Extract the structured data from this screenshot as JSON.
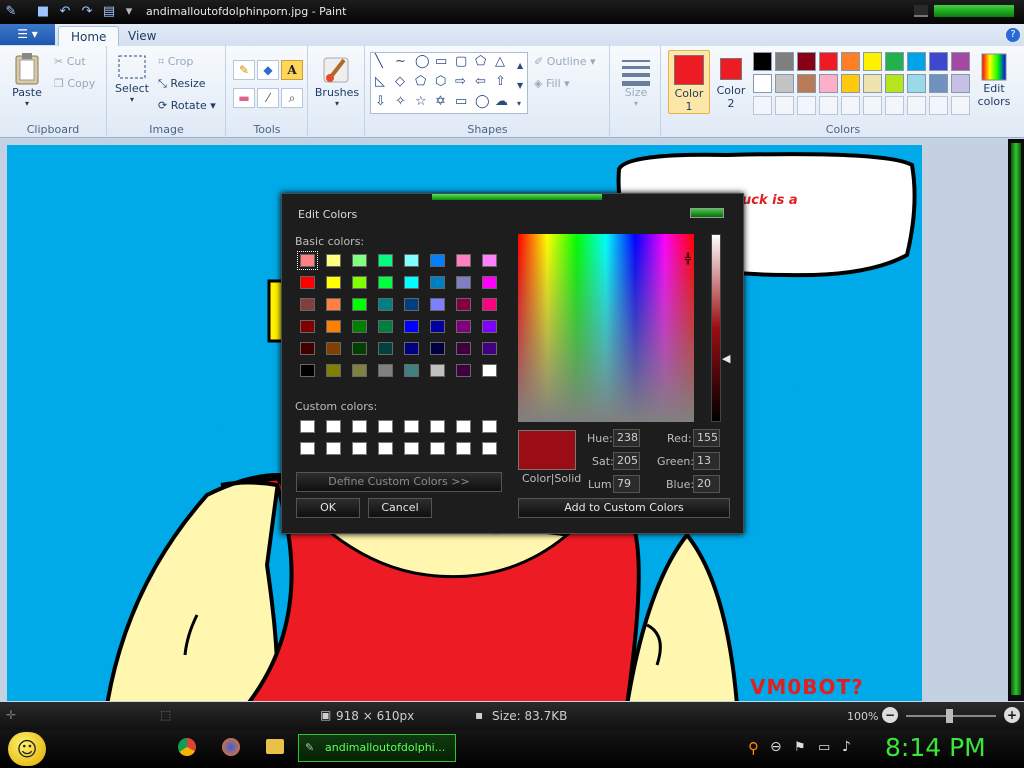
{
  "window": {
    "title": "andimalloutofdolphinporn.jpg - Paint"
  },
  "tabs": {
    "file": "☰ ▾",
    "home": "Home",
    "view": "View"
  },
  "clipboard": {
    "label": "Clipboard",
    "paste": "Paste",
    "cut": "Cut",
    "copy": "Copy"
  },
  "image": {
    "label": "Image",
    "select": "Select",
    "crop": "Crop",
    "resize": "Resize",
    "rotate": "Rotate"
  },
  "tools": {
    "label": "Tools",
    "text_tool": "A"
  },
  "brushes": {
    "label": "Brushes"
  },
  "shapes": {
    "label": "Shapes",
    "outline": "Outline",
    "fill": "Fill"
  },
  "size": {
    "label": "Size"
  },
  "colors": {
    "label": "Colors",
    "color1_line1": "Color",
    "color1_line2": "1",
    "color2_line1": "Color",
    "color2_line2": "2",
    "edit_line1": "Edit",
    "edit_line2": "colors",
    "color1": "#ed1c24",
    "color2": "#ed1c24",
    "palette": [
      "#000000",
      "#7f7f7f",
      "#880015",
      "#ed1c24",
      "#ff7f27",
      "#fff200",
      "#22b14c",
      "#00a2e8",
      "#3f48cc",
      "#a349a4",
      "#ffffff",
      "#c3c3c3",
      "#b97a57",
      "#ffaec9",
      "#ffc90e",
      "#efe4b0",
      "#b5e61d",
      "#99d9ea",
      "#7092be",
      "#c8bfe7"
    ]
  },
  "canvas_texts": {
    "bubble": "uck is a",
    "robot": "VM0BOT?"
  },
  "dialog": {
    "title": "Edit Colors",
    "basic_label": "Basic colors:",
    "custom_label": "Custom colors:",
    "define_button": "Define Custom Colors >>",
    "ok_button": "OK",
    "cancel_button": "Cancel",
    "add_button": "Add to Custom Colors",
    "color_solid": "Color|Solid",
    "selected_color": "#9b0d14",
    "fields": {
      "hue_label": "Hue:",
      "hue": "238",
      "sat_label": "Sat:",
      "sat": "205",
      "lum_label": "Lum:",
      "lum": "79",
      "red_label": "Red:",
      "red": "155",
      "green_label": "Green:",
      "green": "13",
      "blue_label": "Blue:",
      "blue": "20"
    },
    "basic_colors": [
      "#ff8080",
      "#ffff80",
      "#80ff80",
      "#00ff80",
      "#80ffff",
      "#0080ff",
      "#ff80c0",
      "#ff80ff",
      "#ff0000",
      "#ffff00",
      "#80ff00",
      "#00ff40",
      "#00ffff",
      "#0080c0",
      "#8080c0",
      "#ff00ff",
      "#804040",
      "#ff8040",
      "#00ff00",
      "#008080",
      "#004080",
      "#8080ff",
      "#800040",
      "#ff0080",
      "#800000",
      "#ff8000",
      "#008000",
      "#008040",
      "#0000ff",
      "#0000a0",
      "#800080",
      "#8000ff",
      "#400000",
      "#804000",
      "#004000",
      "#004040",
      "#000080",
      "#000040",
      "#400040",
      "#400080",
      "#000000",
      "#808000",
      "#808040",
      "#808080",
      "#408080",
      "#c0c0c0",
      "#400040",
      "#ffffff"
    ]
  },
  "status": {
    "dimensions": "918 × 610px",
    "size": "Size: 83.7KB",
    "zoom": "100%"
  },
  "taskbar": {
    "task_label": "andimalloutofdolphi...",
    "clock": "8:14 PM"
  }
}
